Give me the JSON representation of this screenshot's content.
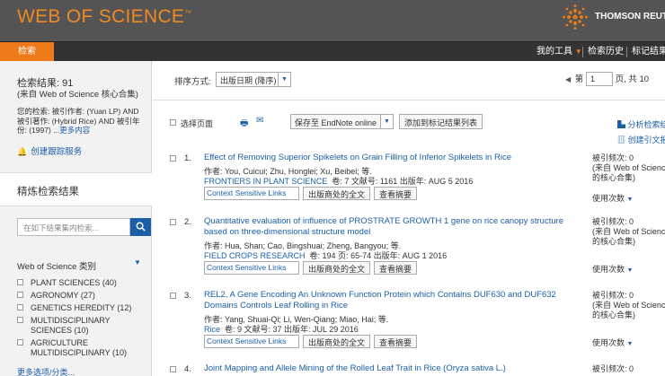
{
  "header": {
    "logo": "WEB OF SCIENCE",
    "logo_tm": "™",
    "vendor": "THOMSON REUTERS"
  },
  "nav": {
    "search": "检索",
    "my_tools": "我的工具",
    "history": "检索历史",
    "marked": "标记结果"
  },
  "left": {
    "result_count": "检索结果: 91",
    "source": "(来自 Web of Science 核心合集)",
    "query": "您的检索: 被引作者: (Yuan LP) AND 被引著作: (Hybrid Rice) AND 被引年份: (1997) ...",
    "query_more": "更多内容",
    "alert": "创建跟踪服务",
    "refine_title": "精炼检索结果",
    "search_placeholder": "在如下结果集内检索...",
    "category_title": "Web of Science 类别",
    "categories": [
      {
        "label": "PLANT SCIENCES (40)"
      },
      {
        "label": "AGRONOMY (27)"
      },
      {
        "label": "GENETICS HEREDITY (12)"
      },
      {
        "label": "MULTIDISCIPLINARY SCIENCES (10)"
      },
      {
        "label": "AGRICULTURE MULTIDISCIPLINARY (10)"
      }
    ],
    "more_options": "更多选项/分类..."
  },
  "sort": {
    "label": "排序方式:",
    "value": "出版日期 (降序)",
    "page_prefix": "第",
    "page_value": "1",
    "page_suffix": "页, 共",
    "page_total": "10"
  },
  "toolbar": {
    "select_page": "选择页面",
    "endnote": "保存至 EndNote online",
    "add_marked": "添加到标记结果列表",
    "analyze": "分析检索结果",
    "citation": "创建引文报告"
  },
  "records": [
    {
      "num": "1.",
      "title": "Effect of Removing Superior Spikelets on Grain Filling of Inferior Spikelets in Rice",
      "authors": "作者: You, Cuicui; Zhu, Honglei; Xu, Beibei; 等.",
      "journal": "FRONTIERS IN PLANT SCIENCE",
      "details": "卷: 7   文献号: 1161   出版年: AUG 5 2016",
      "cite_label": "被引频次: 0",
      "cite_source": "(来自 Web of Science 的核心合集)",
      "usage": "使用次数"
    },
    {
      "num": "2.",
      "title": "Quantitative evaluation of influence of PROSTRATE GROWTH 1 gene on rice canopy structure based on three-dimensional structure model",
      "authors": "作者: Hua, Shan; Cao, Bingshuai; Zheng, Bangyou; 等.",
      "journal": "FIELD CROPS RESEARCH",
      "details": "卷: 194   页: 65-74   出版年: AUG 1 2016",
      "cite_label": "被引频次: 0",
      "cite_source": "(来自 Web of Science 的核心合集)",
      "usage": "使用次数"
    },
    {
      "num": "3.",
      "title": "REL2, A Gene Encoding An Unknown Function Protein which Contains DUF630 and DUF632 Domains Controls Leaf Rolling in Rice",
      "authors": "作者: Yang, Shuai-Qi; Li, Wen-Qiang; Miao, Hai; 等.",
      "journal": "Rice",
      "details": "卷: 9   文献号: 37   出版年: JUL 29 2016",
      "cite_label": "被引频次: 0",
      "cite_source": "(来自 Web of Science 的核心合集)",
      "usage": "使用次数"
    },
    {
      "num": "4.",
      "title": "Joint Mapping and Allele Mining of the Rolled Leaf Trait in Rice (Oryza sativa L.)",
      "cite_label": "被引频次: 0"
    }
  ],
  "record_buttons": {
    "csl": "Context Sensitive Links",
    "fulltext": "出版商处的全文",
    "abstract": "查看摘要"
  },
  "colors": {
    "brand_orange": "#ef7a1a",
    "link_blue": "#1b5fa8",
    "header_gray": "#545454"
  }
}
